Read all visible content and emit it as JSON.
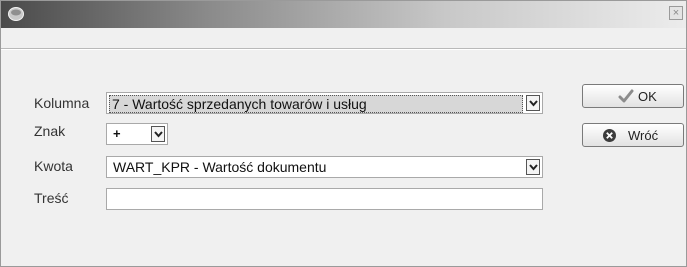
{
  "window": {
    "title": "",
    "close_glyph": "×",
    "icons": {
      "app": "app-icon",
      "close": "close-icon"
    }
  },
  "form": {
    "kolumna": {
      "label": "Kolumna",
      "value": "7 - Wartość sprzedanych towarów i usług"
    },
    "znak": {
      "label": "Znak",
      "value": "+"
    },
    "kwota": {
      "label": "Kwota",
      "value": "WART_KPR  - Wartość dokumentu"
    },
    "tresc": {
      "label": "Treść",
      "value": ""
    }
  },
  "buttons": {
    "ok": {
      "label": "OK",
      "icon": "checkmark-icon"
    },
    "back": {
      "label": "Wróć",
      "icon": "cancel-icon"
    }
  }
}
